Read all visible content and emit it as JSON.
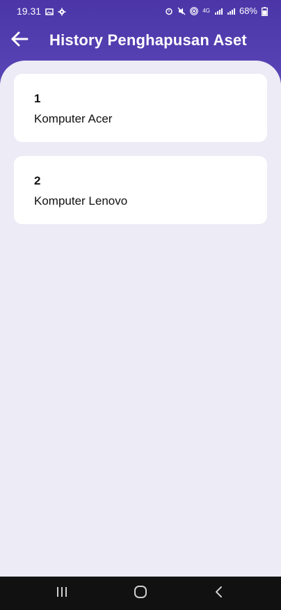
{
  "status_bar": {
    "time": "19.31",
    "battery": "68%",
    "network": "4G"
  },
  "app_bar": {
    "title": "History Penghapusan Aset"
  },
  "items": [
    {
      "number": "1",
      "name": "Komputer Acer"
    },
    {
      "number": "2",
      "name": "Komputer Lenovo"
    }
  ],
  "colors": {
    "header": "#4b36a8",
    "background": "#ecebf6",
    "card": "#ffffff",
    "nav_bar": "#111111"
  }
}
